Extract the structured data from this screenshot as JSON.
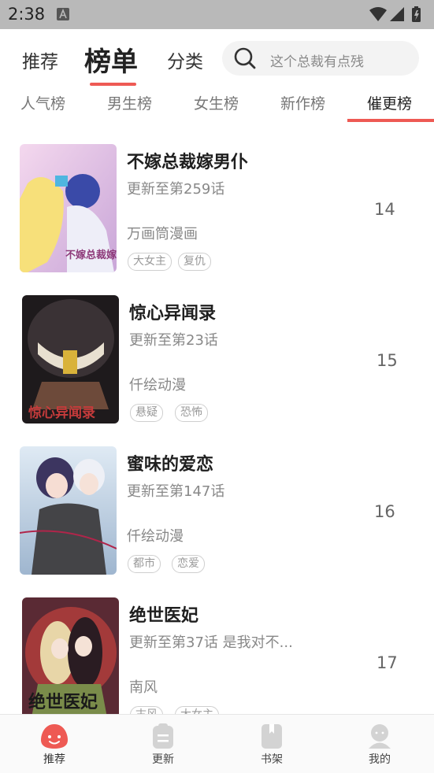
{
  "status_bar": {
    "time": "2:38"
  },
  "top_nav": {
    "tabs": [
      {
        "label": "推荐"
      },
      {
        "label": "榜单"
      },
      {
        "label": "分类"
      }
    ],
    "search": {
      "placeholder": "这个总裁有点残"
    }
  },
  "sub_tabs": [
    {
      "label": "人气榜"
    },
    {
      "label": "男生榜"
    },
    {
      "label": "女生榜"
    },
    {
      "label": "新作榜"
    },
    {
      "label": "催更榜"
    }
  ],
  "colors": {
    "accent": "#ee5a54"
  },
  "comics": [
    {
      "title": "不嫁总裁嫁男仆",
      "update": "更新至第259话",
      "author": "万画筒漫画",
      "tags": [
        "大女主",
        "复仇"
      ],
      "rank": "14",
      "cover_text": "不嫁总裁嫁男仆"
    },
    {
      "title": "惊心异闻录",
      "update": "更新至第23话",
      "author": "仟绘动漫",
      "tags": [
        "悬疑",
        "恐怖"
      ],
      "rank": "15",
      "cover_text": "惊心异闻录"
    },
    {
      "title": "蜜味的爱恋",
      "update": "更新至第147话",
      "author": "仟绘动漫",
      "tags": [
        "都市",
        "恋爱"
      ],
      "rank": "16",
      "cover_text": ""
    },
    {
      "title": "绝世医妃",
      "update": "更新至第37话 是我对不...",
      "author": "南风",
      "tags": [
        "古风",
        "大女主"
      ],
      "rank": "17",
      "cover_text": "绝世医妃"
    }
  ],
  "bottom_nav": [
    {
      "label": "推荐",
      "icon": "smile-icon"
    },
    {
      "label": "更新",
      "icon": "clipboard-icon"
    },
    {
      "label": "书架",
      "icon": "book-icon"
    },
    {
      "label": "我的",
      "icon": "user-icon"
    }
  ]
}
